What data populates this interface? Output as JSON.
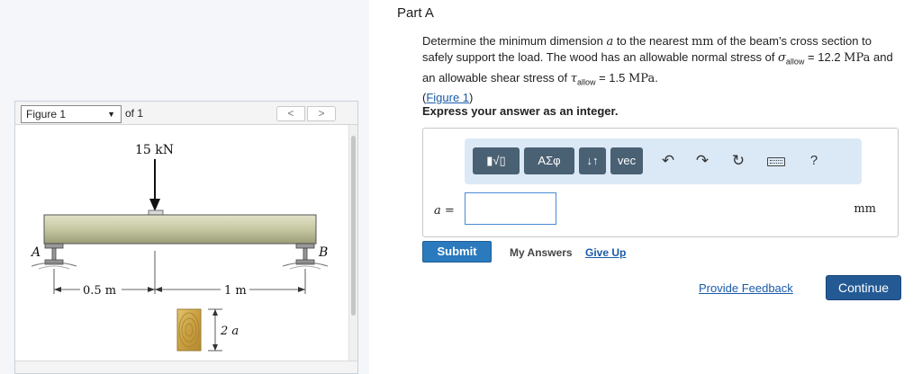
{
  "figure_panel": {
    "select_label": "Figure 1",
    "of_label": "of 1",
    "prev_label": "<",
    "next_label": ">",
    "diagram": {
      "load_label": "15 kN",
      "support_a_label": "A",
      "support_b_label": "B",
      "dim_left_label": "0.5 m",
      "dim_right_label": "1 m",
      "section_label": "2 a"
    }
  },
  "question": {
    "part_title": "Part A",
    "text_1": "Determine the minimum dimension ",
    "var_a": "a",
    "text_2": " to the nearest ",
    "unit_mm": "mm",
    "text_3": " of the beam’s cross section to safely support the load. The wood has an allowable normal stress of ",
    "sigma": "σ",
    "allow_sub": "allow",
    "text_4": " = 12.2 ",
    "unit_mpa_1": "MPa",
    "text_5": " and an allowable shear stress of ",
    "tau": "τ",
    "text_6": " = 1.5 ",
    "unit_mpa_2": "MPa",
    "text_7": ".",
    "link_open": "(",
    "link_text": "Figure 1",
    "link_close": ")",
    "instruction": "Express your answer as an integer."
  },
  "toolbar": {
    "templates_label": "▮√▯",
    "greek_label": "ΑΣφ",
    "arrows_label": "↓↑",
    "vec_label": "vec",
    "undo_icon": "↶",
    "redo_icon": "↷",
    "reset_icon": "↻",
    "help_label": "?"
  },
  "answer": {
    "variable": "a",
    "equals": " =",
    "value": "",
    "unit": "mm"
  },
  "actions": {
    "submit_label": "Submit",
    "my_answers_label": "My Answers",
    "give_up_label": "Give Up",
    "feedback_label": "Provide Feedback",
    "continue_label": "Continue"
  }
}
